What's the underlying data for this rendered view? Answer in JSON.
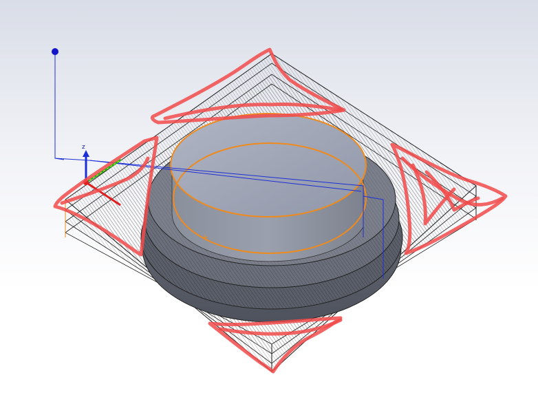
{
  "viewport": {
    "background_top": "#d9dde7",
    "background_bottom": "#ffffff"
  },
  "colors": {
    "edge_orange": "#f08a1c",
    "section_blue": "#1c2fd6",
    "hatch": "#1a1a1a",
    "body_light": "#a4aab9",
    "body_dark": "#5f6470",
    "markup_red": "#f24a4a"
  },
  "triad": {
    "z_label": "z",
    "x_color": "#e02020",
    "y_color": "#22b022",
    "z_color": "#1c2fd6"
  },
  "icons": [
    "origin-point-icon",
    "coordinate-triad-icon",
    "sketch-point-icon"
  ]
}
